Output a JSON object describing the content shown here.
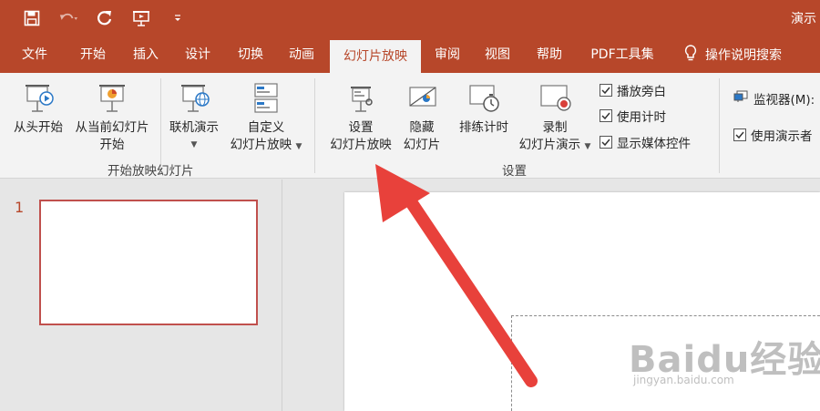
{
  "title": {
    "app_title": "演示"
  },
  "quick_access": [
    {
      "name": "save-icon"
    },
    {
      "name": "undo-icon"
    },
    {
      "name": "redo-icon"
    },
    {
      "name": "present-icon"
    },
    {
      "name": "customize-icon"
    }
  ],
  "tabs": [
    "文件",
    "开始",
    "插入",
    "设计",
    "切换",
    "动画",
    "幻灯片放映",
    "审阅",
    "视图",
    "帮助",
    "PDF工具集"
  ],
  "tellme": {
    "label": "操作说明搜索",
    "icon": "lightbulb-icon"
  },
  "ribbon": {
    "start_group": {
      "from_beginning": "从头开始",
      "from_current_1": "从当前幻灯片",
      "from_current_2": "开始",
      "online": "联机演示",
      "custom_1": "自定义",
      "custom_2": "幻灯片放映",
      "label": "开始放映幻灯片"
    },
    "setup_group": {
      "setup_1": "设置",
      "setup_2": "幻灯片放映",
      "hide_1": "隐藏",
      "hide_2": "幻灯片",
      "rehearse": "排练计时",
      "record_1": "录制",
      "record_2": "幻灯片演示",
      "play_narrations": "播放旁白",
      "use_timings": "使用计时",
      "show_media": "显示媒体控件",
      "label": "设置"
    },
    "monitors_group": {
      "monitor": "监视器(M):",
      "presenter_view": "使用演示者"
    }
  },
  "slides": {
    "number": "1"
  },
  "watermark": {
    "brand": "Baidu经验",
    "url": "jingyan.baidu.com"
  },
  "colors": {
    "accent": "#b7472a",
    "arrow": "#e8413b"
  }
}
